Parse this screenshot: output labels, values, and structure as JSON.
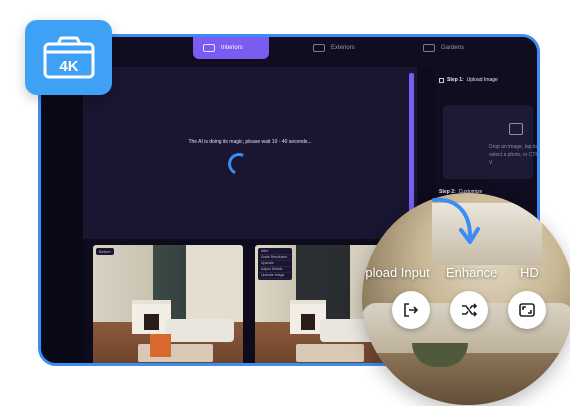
{
  "tabs": [
    {
      "label": "Interiors",
      "active": true
    },
    {
      "label": "Exteriors",
      "active": false
    },
    {
      "label": "Gardens",
      "active": false
    }
  ],
  "main": {
    "status_message": "The AI is doing its magic, please wait 10 - 40 seconds..."
  },
  "panel": {
    "step1": {
      "prefix": "Step 1:",
      "text": "Upload Image"
    },
    "upload_hint": "Drop an image, tap to select a photo, or CTRL + V",
    "step2": {
      "prefix": "Step 2:",
      "text": "Customize"
    }
  },
  "photos": [
    {
      "label": "Before"
    },
    {
      "menu": [
        "After",
        "Scale Resolution",
        "Upscale",
        "Adjust Details",
        "Upscale Image"
      ]
    }
  ],
  "badge": {
    "label": "4K"
  },
  "zoom": {
    "labels": [
      "Upload Input",
      "Enhance",
      "HD"
    ],
    "buttons": [
      "exit-icon",
      "shuffle-icon",
      "expand-icon"
    ]
  },
  "colors": {
    "accent": "#7a5cf0",
    "brand_blue": "#3b8df5",
    "badge_blue": "#3fa1f5",
    "background": "#1a1530"
  }
}
